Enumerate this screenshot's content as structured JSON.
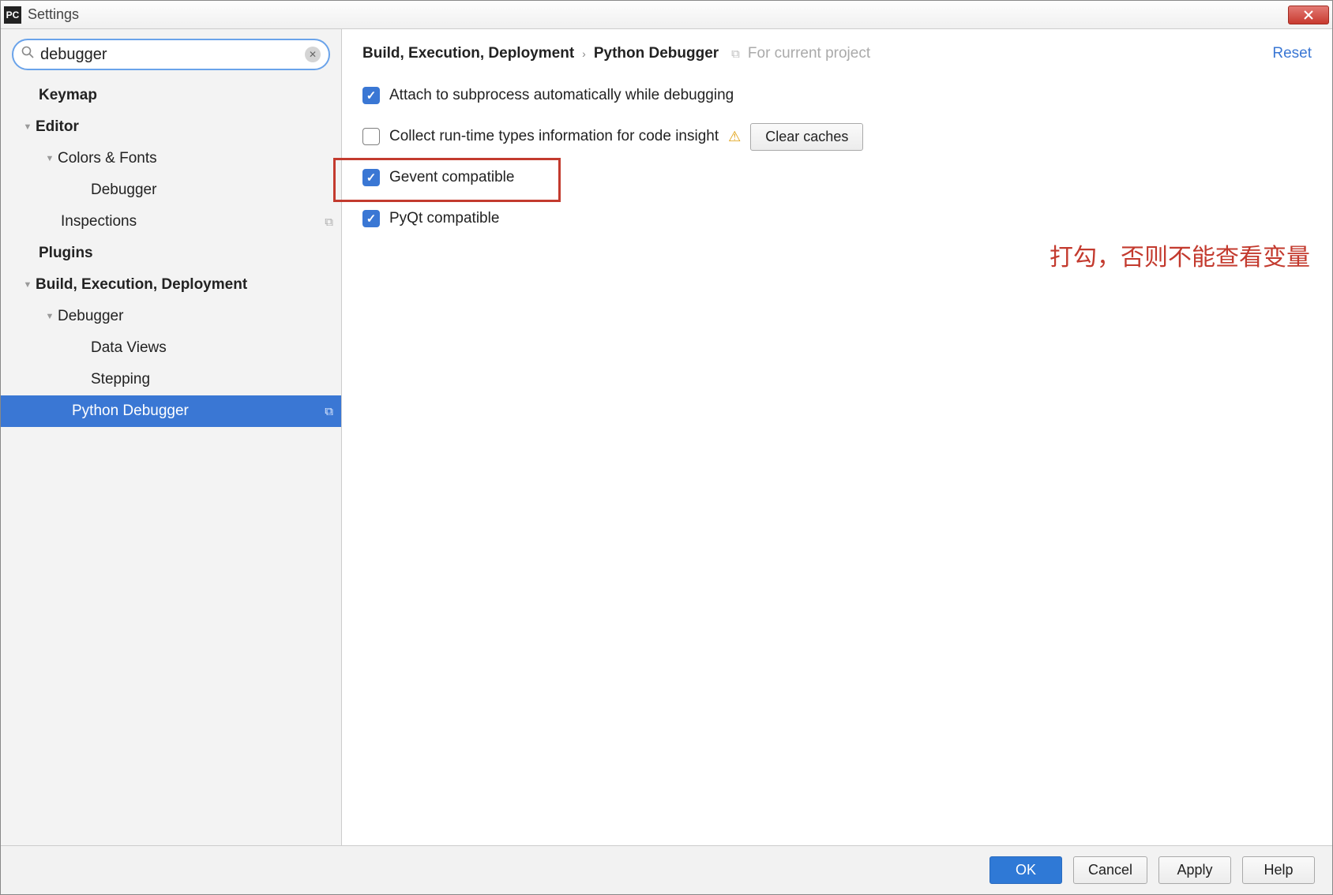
{
  "window": {
    "title": "Settings",
    "app_icon_text": "PC"
  },
  "search": {
    "value": "debugger",
    "placeholder": ""
  },
  "tree": {
    "keymap": "Keymap",
    "editor": "Editor",
    "colors_fonts": "Colors & Fonts",
    "colors_fonts_debugger": "Debugger",
    "inspections": "Inspections",
    "plugins": "Plugins",
    "bed": "Build, Execution, Deployment",
    "bed_debugger": "Debugger",
    "data_views": "Data Views",
    "stepping": "Stepping",
    "python_debugger": "Python Debugger"
  },
  "breadcrumb": {
    "parent": "Build, Execution, Deployment",
    "leaf": "Python Debugger",
    "scope": "For current project"
  },
  "reset_label": "Reset",
  "options": {
    "attach": {
      "label": "Attach to subprocess automatically while debugging",
      "checked": true
    },
    "collect": {
      "label": "Collect run-time types information for code insight",
      "checked": false
    },
    "gevent": {
      "label": "Gevent compatible",
      "checked": true
    },
    "pyqt": {
      "label": "PyQt compatible",
      "checked": true
    }
  },
  "clear_caches_label": "Clear caches",
  "annotation_text": "打勾，否则不能查看变量",
  "footer": {
    "ok": "OK",
    "cancel": "Cancel",
    "apply": "Apply",
    "help": "Help"
  }
}
